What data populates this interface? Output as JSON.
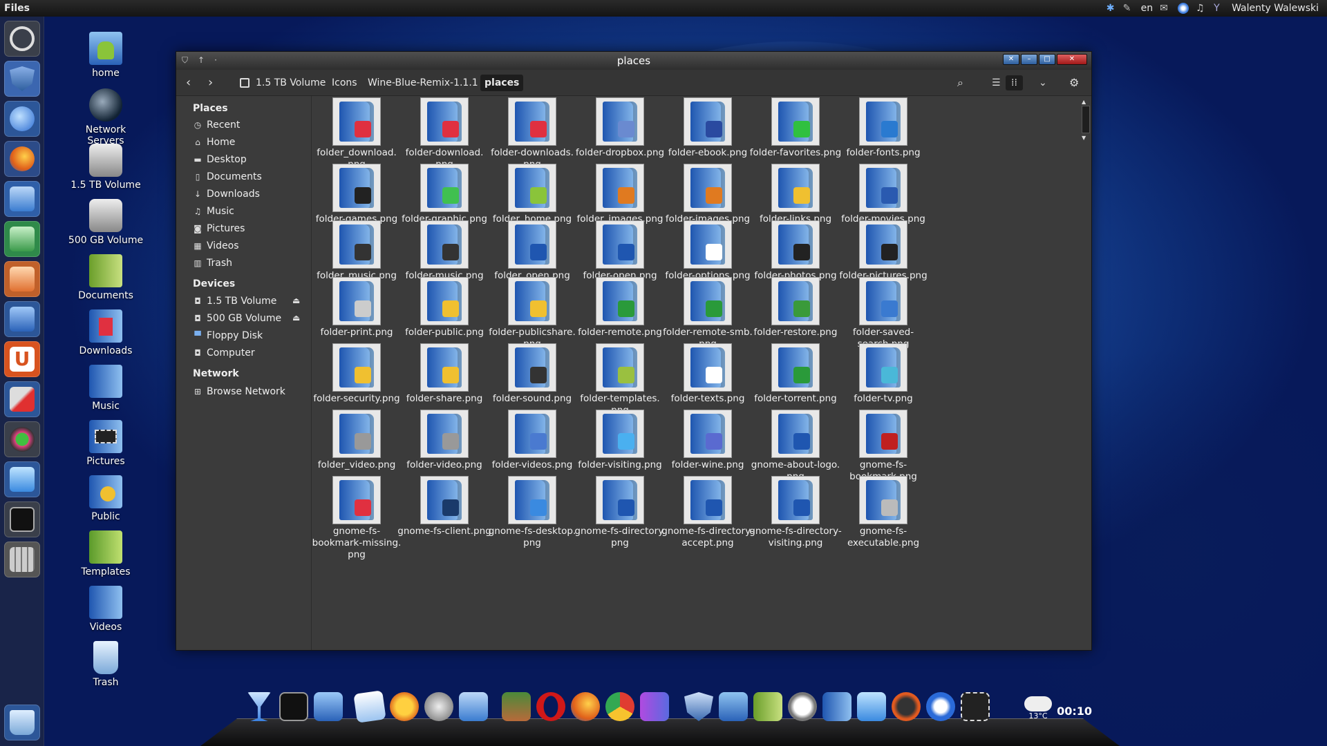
{
  "top_panel": {
    "app_name": "Files",
    "keyboard": "en",
    "user": "Walenty Walewski"
  },
  "desktop_icons": [
    "home",
    "Network Servers",
    "1.5 TB Volume",
    "500 GB Volume",
    "Documents",
    "Downloads",
    "Music",
    "Pictures",
    "Public",
    "Templates",
    "Videos",
    "Trash"
  ],
  "window": {
    "title": "places",
    "breadcrumbs": [
      "1.5 TB Volume",
      "Icons",
      "Wine-Blue-Remix-1.1.1",
      "places"
    ]
  },
  "sidebar": {
    "places_header": "Places",
    "places": [
      "Recent",
      "Home",
      "Desktop",
      "Documents",
      "Downloads",
      "Music",
      "Pictures",
      "Videos",
      "Trash"
    ],
    "devices_header": "Devices",
    "devices": [
      "1.5 TB Volume",
      "500 GB Volume",
      "Floppy Disk",
      "Computer"
    ],
    "network_header": "Network",
    "network": [
      "Browse Network"
    ]
  },
  "files": [
    "folder_download.\npng",
    "folder-download.\npng",
    "folder-downloads.\npng",
    "folder-dropbox.png",
    "folder-ebook.png",
    "folder-favorites.png",
    "folder-fonts.png",
    "folder-games.png",
    "folder-graphic.png",
    "folder_home.png",
    "folder_images.png",
    "folder-images.png",
    "folder-links.png",
    "folder-movies.png",
    "folder_music.png",
    "folder-music.png",
    "folder_open.png",
    "folder-open.png",
    "folder-options.png",
    "folder-photos.png",
    "folder-pictures.png",
    "folder-print.png",
    "folder-public.png",
    "folder-publicshare.\npng",
    "folder-remote.png",
    "folder-remote-smb.\npng",
    "folder-restore.png",
    "folder-saved-\nsearch.png",
    "folder-security.png",
    "folder-share.png",
    "folder-sound.png",
    "folder-templates.\npng",
    "folder-texts.png",
    "folder-torrent.png",
    "folder-tv.png",
    "folder_video.png",
    "folder-video.png",
    "folder-videos.png",
    "folder-visiting.png",
    "folder-wine.png",
    "gnome-about-logo.\npng",
    "gnome-fs-\nbookmark.png",
    "gnome-fs-\nbookmark-missing.\npng",
    "gnome-fs-client.png",
    "gnome-fs-desktop.\npng",
    "gnome-fs-directory.\npng",
    "gnome-fs-directory-\naccept.png",
    "gnome-fs-directory-\nvisiting.png",
    "gnome-fs-\nexecutable.png"
  ],
  "dock": {
    "clock": "00:10",
    "temperature": "13°C"
  }
}
